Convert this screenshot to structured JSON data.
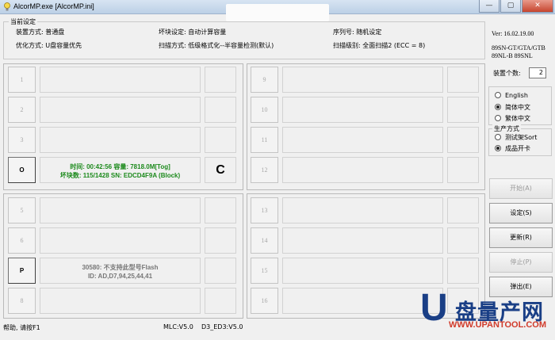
{
  "window": {
    "title": "AlcorMP.exe [AlcorMP.ini]",
    "controls": {
      "minimize": "—",
      "maximize": "▢",
      "close": "✕"
    }
  },
  "info": {
    "group_title": "当前设定",
    "install_mode": "装置方式: 普通盘",
    "optimize_mode": "优化方式: U盘容量优先",
    "bad_block_setting": "坏块设定: 自动计算容量",
    "scan_mode": "扫描方式: 低级格式化--半容量检测(默认)",
    "serial": "序列号: 随机设定",
    "scan_level": "扫描级别: 全面扫描2 (ECC = 8)"
  },
  "slots": {
    "top_left": [
      {
        "label": "1",
        "active": false
      },
      {
        "label": "2",
        "active": false
      },
      {
        "label": "3",
        "active": false
      },
      {
        "label": "O",
        "active": true,
        "status": "C",
        "message_line1": "时间: 00:42:56 容量: 7818.0M[Tog]",
        "message_line2": "坏块数: 115/1428 SN: EDCD4F9A (Block)"
      }
    ],
    "top_right": [
      {
        "label": "9"
      },
      {
        "label": "10"
      },
      {
        "label": "11"
      },
      {
        "label": "12"
      }
    ],
    "bottom_left": [
      {
        "label": "5",
        "active": false
      },
      {
        "label": "6",
        "active": false
      },
      {
        "label": "P",
        "active": true,
        "message_line1": "30580: 不支持此型号Flash",
        "message_line2": "ID: AD,D7,94,25,44,41"
      },
      {
        "label": "8",
        "active": false
      }
    ],
    "bottom_right": [
      {
        "label": "13"
      },
      {
        "label": "14"
      },
      {
        "label": "15"
      },
      {
        "label": "16"
      }
    ]
  },
  "right": {
    "version": "Ver: 16.02.19.00",
    "chip_line1": "89SN-GT/GTA/GTB",
    "chip_line2": "89NL-B 89SNL",
    "device_count_label": "装置个数:",
    "device_count": "2",
    "language": {
      "options": [
        "English",
        "简体中文",
        "繁体中文"
      ],
      "selected": "简体中文"
    },
    "production_group_title": "生产方式",
    "production": {
      "options": [
        "测试架Sort",
        "成品开卡"
      ],
      "selected": "成品开卡"
    },
    "buttons": {
      "start": "开始(A)",
      "settings": "设定(S)",
      "refresh": "更新(R)",
      "stop": "停止(P)",
      "exit": "弹出(E)"
    }
  },
  "statusbar": {
    "help": "帮助, 请按F1",
    "mlc": "MLC:V5.0",
    "d3": "D3_ED3:V5.0"
  },
  "watermark": {
    "letter": "U",
    "text": "盘量产网",
    "url": "WWW.UPANTOOL.COM"
  },
  "colors": {
    "ok_message": "#1c8a1c",
    "error_message": "#777777",
    "watermark_blue": "#1a3f86",
    "watermark_red": "#d13b2b"
  }
}
